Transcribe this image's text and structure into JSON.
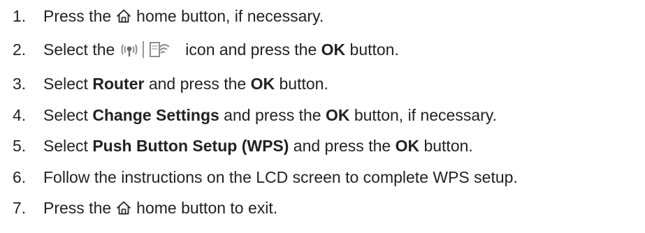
{
  "steps": [
    {
      "number": "1.",
      "parts": {
        "a": "Press the",
        "icon": "home-icon",
        "b": "home button, if necessary."
      }
    },
    {
      "number": "2.",
      "parts": {
        "a": "Select the",
        "icon": "wifi-settings-icon",
        "b": "icon and press the ",
        "c": "OK",
        "d": " button."
      }
    },
    {
      "number": "3.",
      "parts": {
        "a": "Select ",
        "b": "Router",
        "c": " and press the ",
        "d": "OK",
        "e": " button."
      }
    },
    {
      "number": "4.",
      "parts": {
        "a": "Select ",
        "b": "Change Settings",
        "c": " and press the ",
        "d": "OK",
        "e": " button, if necessary."
      }
    },
    {
      "number": "5.",
      "parts": {
        "a": "Select ",
        "b": "Push Button Setup (WPS)",
        "c": " and press the ",
        "d": "OK",
        "e": " button."
      }
    },
    {
      "number": "6.",
      "parts": {
        "a": "Follow the instructions on the LCD screen to complete WPS setup."
      }
    },
    {
      "number": "7.",
      "parts": {
        "a": "Press the",
        "icon": "home-icon",
        "b": "home button to exit."
      }
    }
  ]
}
